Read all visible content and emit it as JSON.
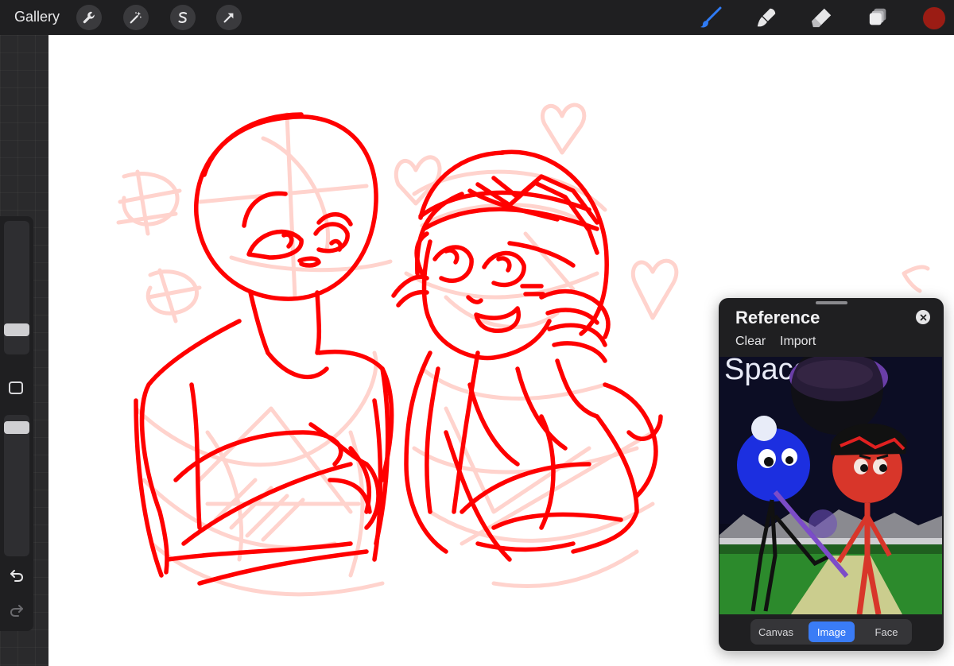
{
  "topbar": {
    "gallery_label": "Gallery",
    "left_tools": [
      "wrench-icon",
      "magic-wand-icon",
      "selection-s-icon",
      "transform-arrow-icon"
    ],
    "right_tools": [
      "brush-icon",
      "smudge-icon",
      "eraser-icon",
      "layers-icon"
    ],
    "current_color": "#9b1c14",
    "brush_active_color": "#2f7bf5"
  },
  "reference_panel": {
    "title": "Reference",
    "clear_label": "Clear",
    "import_label": "Import",
    "image_text": "Space",
    "tabs": [
      {
        "label": "Canvas",
        "active": false
      },
      {
        "label": "Image",
        "active": true
      },
      {
        "label": "Face",
        "active": false
      }
    ]
  },
  "colors": {
    "sketch_red": "#ff0000",
    "sketch_pink": "#ffd5d0",
    "accent_blue": "#3a7cf6"
  }
}
